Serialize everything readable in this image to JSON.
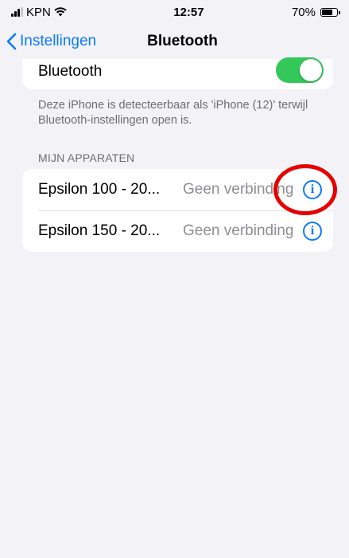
{
  "status_bar": {
    "carrier": "KPN",
    "time": "12:57",
    "battery_percent": "70%",
    "battery_level": 0.7,
    "signal_icon": "cellular-signal-icon",
    "wifi_icon": "wifi-icon",
    "battery_icon": "battery-icon"
  },
  "nav": {
    "back_label": "Instellingen",
    "title": "Bluetooth"
  },
  "bluetooth": {
    "label": "Bluetooth",
    "enabled": true,
    "toggle_color": "#34c759"
  },
  "discoverable_note": "Deze iPhone is detecteerbaar als 'iPhone (12)' terwijl Bluetooth-instellingen open is.",
  "my_devices": {
    "header": "MIJN APPARATEN",
    "items": [
      {
        "name": "Epsilon 100 - 20...",
        "status": "Geen verbinding"
      },
      {
        "name": "Epsilon 150 - 20...",
        "status": "Geen verbinding"
      }
    ]
  },
  "colors": {
    "accent": "#0a7aff",
    "annotation": "#e60000",
    "background": "#f2f2f7"
  }
}
